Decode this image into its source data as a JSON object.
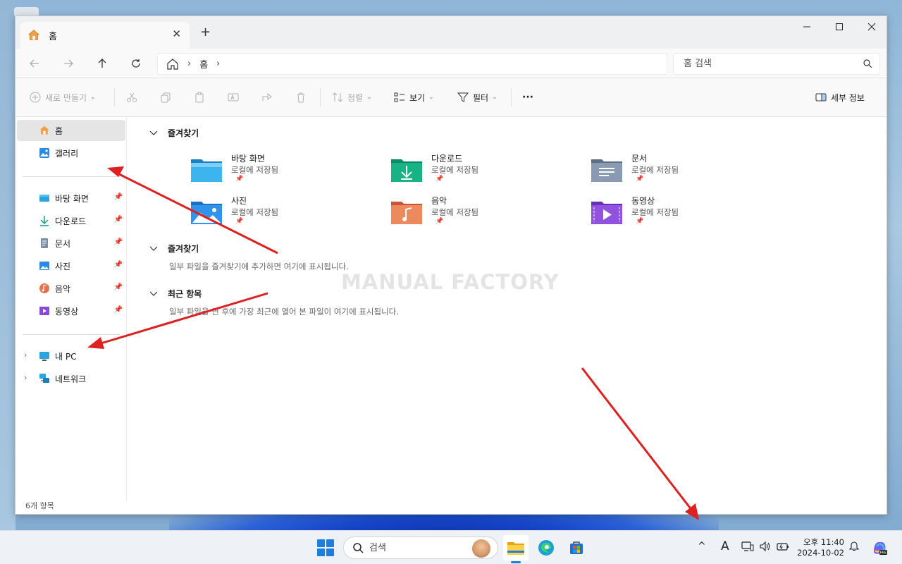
{
  "window": {
    "tab_title": "홈",
    "new_tab": "+",
    "tab_close": "✕"
  },
  "address": {
    "crumb": "홈",
    "sep1": "›",
    "sep2": "›",
    "search_placeholder": "홈 검색"
  },
  "toolbar": {
    "new_label": "새로 만들기",
    "sort_label": "정렬",
    "view_label": "보기",
    "filter_label": "필터",
    "more_label": "···",
    "details_label": "세부 정보"
  },
  "sidebar": {
    "home": "홈",
    "gallery": "갤러리",
    "pinned": [
      {
        "label": "바탕 화면",
        "icon": "desktop-icon"
      },
      {
        "label": "다운로드",
        "icon": "download-icon"
      },
      {
        "label": "문서",
        "icon": "document-icon"
      },
      {
        "label": "사진",
        "icon": "picture-icon"
      },
      {
        "label": "음악",
        "icon": "music-icon"
      },
      {
        "label": "동영상",
        "icon": "video-icon"
      }
    ],
    "this_pc": "내 PC",
    "network": "네트워크"
  },
  "content": {
    "favorites_title": "즐겨찾기",
    "folders": [
      {
        "name": "바탕 화면",
        "sub": "로컬에 저장됨"
      },
      {
        "name": "다운로드",
        "sub": "로컬에 저장됨"
      },
      {
        "name": "문서",
        "sub": "로컬에 저장됨"
      },
      {
        "name": "사진",
        "sub": "로컬에 저장됨"
      },
      {
        "name": "음악",
        "sub": "로컬에 저장됨"
      },
      {
        "name": "동영상",
        "sub": "로컬에 저장됨"
      }
    ],
    "favorites2_title": "즐겨찾기",
    "favorites2_empty": "일부 파일을 즐겨찾기에 추가하면 여기에 표시됩니다.",
    "recent_title": "최근 항목",
    "recent_empty": "일부 파일을 연 후에 가장 최근에 열어 본 파일이 여기에 표시됩니다.",
    "watermark": "MANUAL FACTORY",
    "status": "6개 항목"
  },
  "taskbar": {
    "search_placeholder": "검색",
    "time": "오후 11:40",
    "date": "2024-10-02",
    "ime": "A",
    "overflow": "^"
  },
  "colors": {
    "accent": "#1c7fe0",
    "annotation_arrow": "#e02020"
  }
}
